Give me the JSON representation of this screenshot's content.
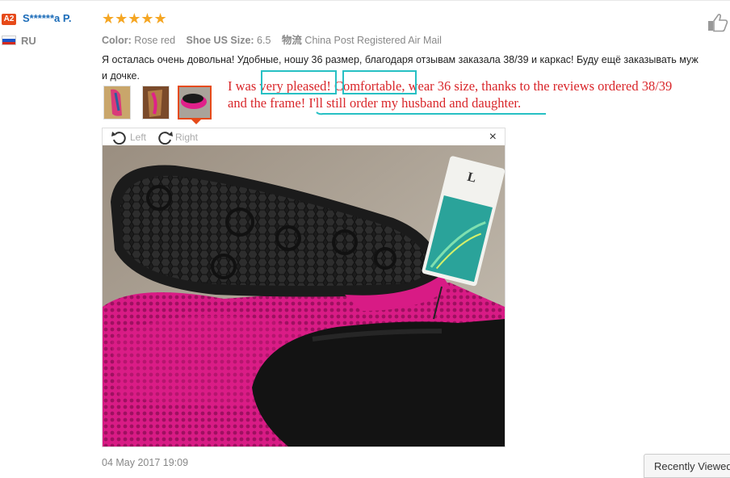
{
  "reviewer": {
    "level_badge": "A2",
    "name": "S******a P.",
    "country": "RU",
    "rating_stars": "★★★★★",
    "rating": 5
  },
  "order": {
    "color_label": "Color:",
    "color_value": "Rose red",
    "size_label": "Shoe US Size:",
    "size_value": "6.5",
    "shipping_label": "物流",
    "shipping_value": "China Post Registered Air Mail"
  },
  "review_text": {
    "line1": "Я осталась очень довольна! Удобные, ношу 36 размер, благодаря отзывам заказала 38/39 и каркас! Буду ещё заказывать муж",
    "line2": "и дочке."
  },
  "annotation": {
    "line1": "I was very pleased! Comfortable, wear 36 size, thanks to the reviews ordered 38/39",
    "line2": "and the frame! I'll still order my husband and daughter."
  },
  "viewer": {
    "rotate_left_label": "Left",
    "rotate_right_label": "Right",
    "close_glyph": "×"
  },
  "review_date": "04 May 2017 19:09",
  "recently_viewed_label": "Recently Viewed",
  "colors": {
    "accent": "#e64a19",
    "link": "#1a6bb8",
    "star": "#f5a623",
    "annotation_red": "#d9262a",
    "annotation_box": "#27c0c4",
    "shoe_pink": "#e0208a"
  },
  "icons": [
    "thumbs-up-icon",
    "rotate-left-icon",
    "rotate-right-icon",
    "close-icon",
    "russia-flag-icon"
  ]
}
